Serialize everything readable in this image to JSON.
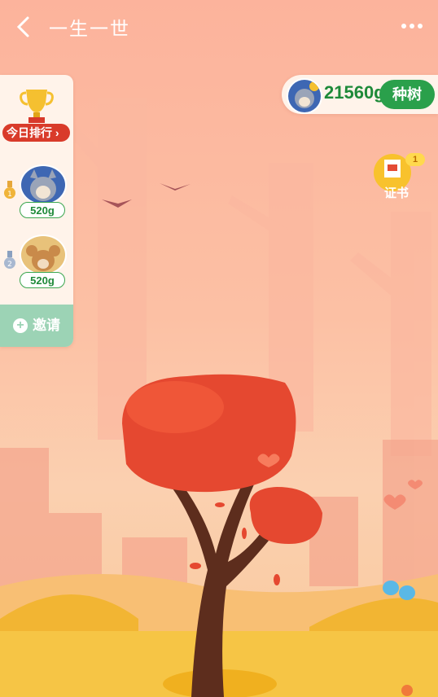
{
  "header": {
    "title": "一生一世"
  },
  "ranking": {
    "today_label": "今日排行",
    "entries": [
      {
        "rank": "1",
        "score": "520g"
      },
      {
        "rank": "2",
        "score": "520g"
      }
    ],
    "invite_label": "邀请"
  },
  "account": {
    "coins": "21560g",
    "plant_label": "种树"
  },
  "certificate": {
    "label": "证书",
    "count": "1"
  },
  "colors": {
    "accent_green": "#2aa04b",
    "rank_red": "#d93b2a",
    "tree_red": "#e54830"
  }
}
